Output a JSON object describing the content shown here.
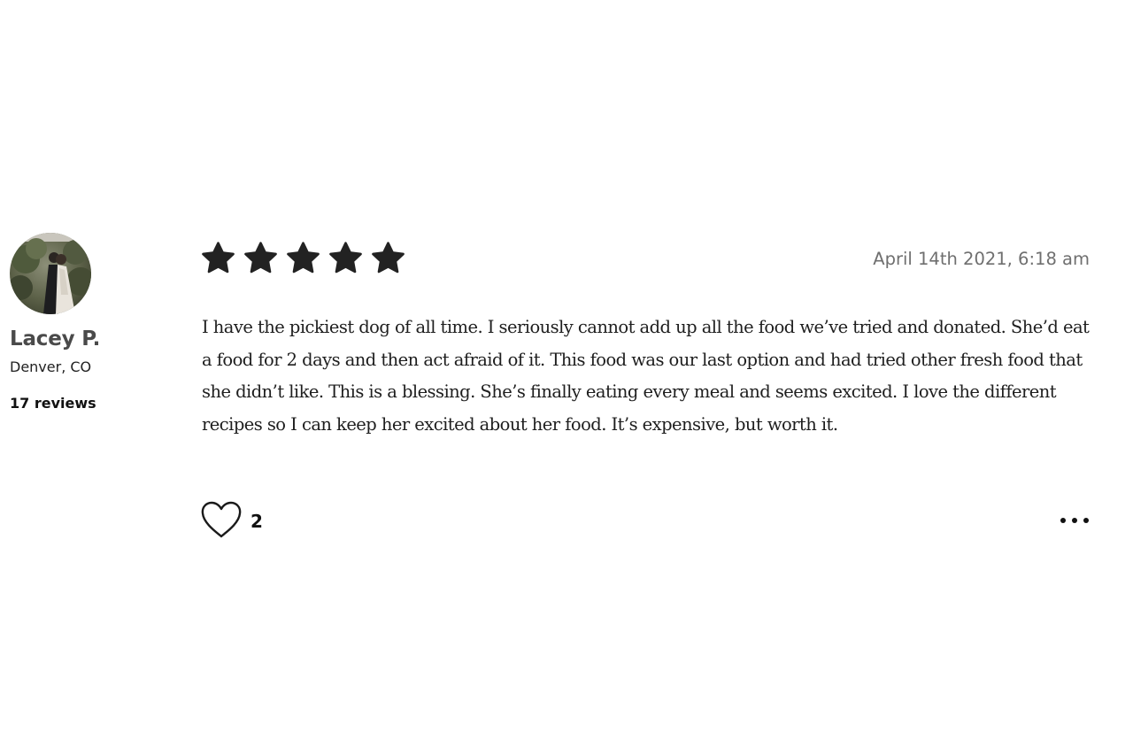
{
  "reviewer": {
    "name": "Lacey P.",
    "location": "Denver, CO",
    "review_count": "17 reviews",
    "avatar_icon": "reviewer-photo"
  },
  "review": {
    "rating": 5,
    "rating_max": 5,
    "date": "April 14th 2021, 6:18 am",
    "body": "I have the pickiest dog of all time. I seriously cannot add up all the food we’ve tried and donated. She’d eat a food for 2 days and then act afraid of it. This food was our last option and had tried other fresh food that she didn’t like. This is a blessing. She’s finally eating every meal and seems excited. I love the different recipes so I can keep her excited about her food. It’s expensive, but worth it.",
    "likes": "2"
  },
  "icons": {
    "star": "star-icon",
    "like": "heart-outline-icon",
    "more": "more-options-icon"
  },
  "colors": {
    "star_fill": "#222222",
    "text": "#1e1e1e",
    "muted": "#6f6f6f"
  }
}
